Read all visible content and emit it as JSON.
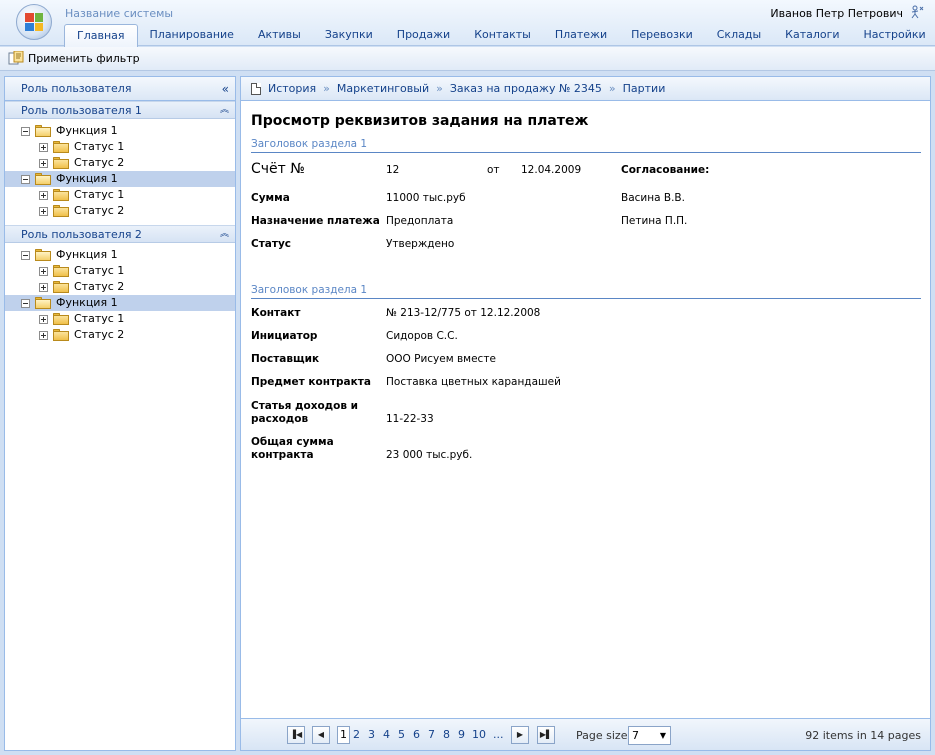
{
  "header": {
    "system_name": "Название системы",
    "user_name": "Иванов Петр Петрович",
    "menu": [
      {
        "label": "Главная",
        "active": true
      },
      {
        "label": "Планирование"
      },
      {
        "label": "Активы"
      },
      {
        "label": "Закупки"
      },
      {
        "label": "Продажи"
      },
      {
        "label": "Контакты"
      },
      {
        "label": "Платежи"
      },
      {
        "label": "Перевозки"
      },
      {
        "label": "Склады"
      },
      {
        "label": "Каталоги"
      },
      {
        "label": "Настройки"
      }
    ]
  },
  "toolbar": {
    "apply_filter": "Применить фильтр"
  },
  "sidebar": {
    "title": "Роль пользователя",
    "collapse_glyph": "«",
    "groups": [
      {
        "title": "Роль пользователя 1",
        "items": [
          {
            "label": "Функция 1",
            "selected": false,
            "children": [
              "Статус 1",
              "Статус 2"
            ]
          },
          {
            "label": "Функция 1",
            "selected": true,
            "children": [
              "Статус 1",
              "Статус 2"
            ]
          }
        ]
      },
      {
        "title": "Роль пользователя 2",
        "items": [
          {
            "label": "Функция 1",
            "selected": false,
            "children": [
              "Статус 1",
              "Статус 2"
            ]
          },
          {
            "label": "Функция 1",
            "selected": true,
            "children": [
              "Статус 1",
              "Статус 2"
            ]
          }
        ]
      }
    ]
  },
  "breadcrumb": [
    "История",
    "Маркетинговый",
    "Заказ на продажу № 2345",
    "Партии"
  ],
  "main": {
    "title": "Просмотр реквизитов задания на платеж",
    "section1": {
      "title": "Заголовок раздела 1",
      "invoice_label": "Счёт №",
      "invoice_number": "12",
      "from_label": "от",
      "date": "12.04.2009",
      "approval_label": "Согласование:",
      "approvers": [
        "Васина В.В.",
        "Петина П.П."
      ],
      "rows": [
        {
          "label": "Сумма",
          "value": "11000 тыс.руб"
        },
        {
          "label": "Назначение платежа",
          "value": "Предоплата"
        },
        {
          "label": "Статус",
          "value": "Утверждено"
        }
      ]
    },
    "section2": {
      "title": "Заголовок раздела 1",
      "rows": [
        {
          "label": "Контакт",
          "value": "№ 213-12/775 от 12.12.2008"
        },
        {
          "label": "Инициатор",
          "value": "Сидоров С.С."
        },
        {
          "label": "Поставщик",
          "value": "ООО Рисуем вместе"
        },
        {
          "label": "Предмет контракта",
          "value": "Поставка цветных карандашей"
        },
        {
          "label": "Статья доходов и расходов",
          "value": "11-22-33"
        },
        {
          "label": "Общая сумма контракта",
          "value": "23 000 тыс.руб."
        }
      ]
    }
  },
  "pager": {
    "pages": [
      "1",
      "2",
      "3",
      "4",
      "5",
      "6",
      "7",
      "8",
      "9",
      "10",
      "..."
    ],
    "current": "1",
    "page_size_label": "Page size:",
    "page_size": "7",
    "info": "92 items in 14 pages"
  },
  "colors": {
    "accent": "#15428b",
    "section": "#5a86c5",
    "selected_row": "#bfd1ec"
  }
}
